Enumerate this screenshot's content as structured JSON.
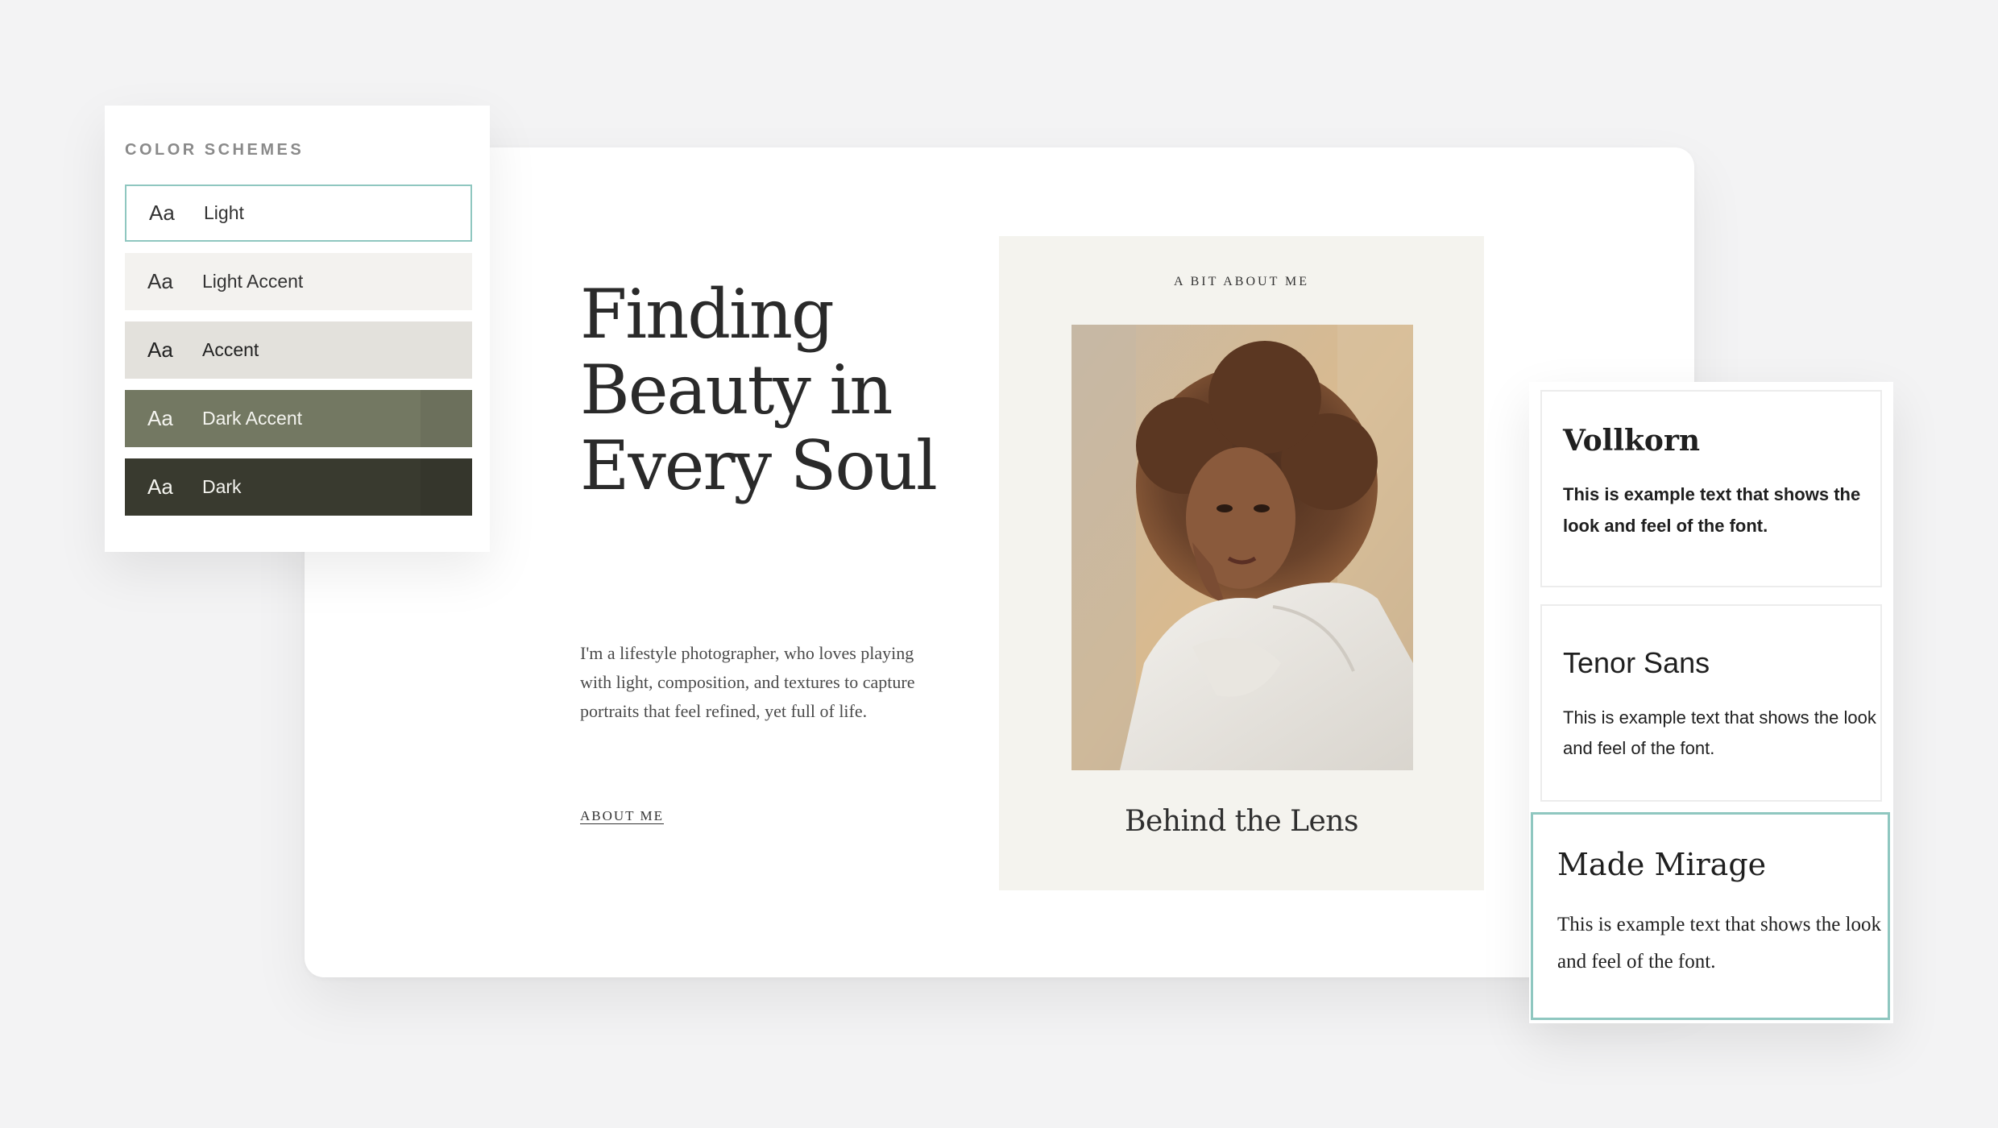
{
  "preview": {
    "hero_title_lines": [
      "Finding",
      "Beauty in",
      "Every Soul"
    ],
    "hero_body": "I'm a lifestyle photographer, who loves playing with light, composition, and textures to capture portraits that feel refined, yet full of life.",
    "about_link": "ABOUT ME",
    "about_eyebrow": "A BIT ABOUT ME",
    "about_caption": "Behind the Lens",
    "portrait_icon": "portrait-photo"
  },
  "color_schemes": {
    "heading": "COLOR SCHEMES",
    "items": [
      {
        "aa": "Aa",
        "label": "Light",
        "bg": "#ffffff",
        "selected": true
      },
      {
        "aa": "Aa",
        "label": "Light Accent",
        "bg": "#f3f2ef",
        "selected": false
      },
      {
        "aa": "Aa",
        "label": "Accent",
        "bg": "#e3e1dc",
        "selected": false
      },
      {
        "aa": "Aa",
        "label": "Dark Accent",
        "bg": "#737862",
        "selected": false
      },
      {
        "aa": "Aa",
        "label": "Dark",
        "bg": "#393a2f",
        "selected": false
      }
    ]
  },
  "fonts": {
    "items": [
      {
        "name": "Vollkorn",
        "sample": "This is example text that shows the look and feel of the font.",
        "selected": false
      },
      {
        "name": "Tenor Sans",
        "sample": "This is example text that shows the look and feel of the font.",
        "selected": false
      },
      {
        "name": "Made Mirage",
        "sample": "This is example text that shows the look and feel of the font.",
        "selected": true
      }
    ]
  },
  "colors": {
    "page_bg": "#f3f3f4",
    "selected_border": "#8fc7c0",
    "about_panel_bg": "#f4f3ee"
  }
}
